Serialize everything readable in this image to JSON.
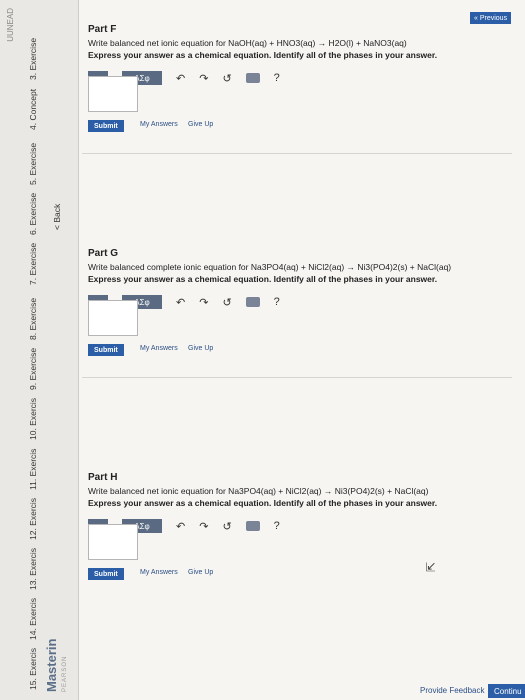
{
  "sidebar": {
    "cut_top": "UUNEAD",
    "items": [
      "3. Exercise",
      "4. Concept",
      "5. Exercise",
      "6. Exercise",
      "7. Exercise",
      "8. Exercise",
      "9. Exercise",
      "10. Exercis",
      "11. Exercis",
      "12. Exercis",
      "13. Exercis",
      "14. Exercis",
      "15. Exercis"
    ],
    "back_label": "< Back",
    "brand": "Masterin",
    "brand_sub": "PEARSON"
  },
  "parts": [
    {
      "title": "Part F",
      "prompt": "Write balanced net ionic equation for NaOH(aq) + HNO3(aq) → H2O(l) + NaNO3(aq)",
      "instruction": "Express your answer as a chemical equation. Identify all of the phases in your answer."
    },
    {
      "title": "Part G",
      "prompt": "Write balanced complete ionic equation for Na3PO4(aq) + NiCl2(aq) → Ni3(PO4)2(s) + NaCl(aq)",
      "instruction": "Express your answer as a chemical equation. Identify all of the phases in your answer."
    },
    {
      "title": "Part H",
      "prompt": "Write balanced net ionic equation for Na3PO4(aq) + NiCl2(aq) → Ni3(PO4)2(s) + NaCl(aq)",
      "instruction": "Express your answer as a chemical equation. Identify all of the phases in your answer."
    }
  ],
  "toolbar": {
    "template_label": "□",
    "greek_label": "ΑΣφ",
    "undo_icon": "↶",
    "redo_icon": "↷",
    "reset_icon": "↺",
    "help_icon": "?"
  },
  "actions": {
    "submit_label": "Submit",
    "my_answers": "My Answers",
    "give_up": "Give Up"
  },
  "footer": {
    "feedback": "Provide Feedback",
    "continue": "Continu",
    "previous": "« Previous"
  }
}
